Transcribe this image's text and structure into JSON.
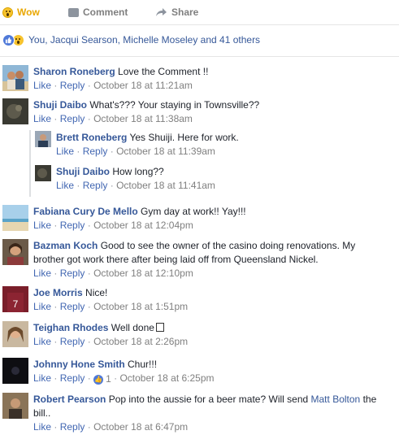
{
  "actions": {
    "wow_label": "Wow",
    "comment_label": "Comment",
    "share_label": "Share"
  },
  "reactions": {
    "summary": "You, Jacqui Searson, Michelle Moseley and 41 others"
  },
  "colors": {
    "link": "#365899",
    "meta": "#7f7f7f",
    "wow": "#e9a700"
  },
  "comments": [
    {
      "author": "Sharon Roneberg",
      "text": "Love the Comment !!",
      "like": "Like",
      "reply": "Reply",
      "time": "October 18 at 11:21am",
      "avatar": "beach-couple-avatar"
    },
    {
      "author": "Shuji Daibo",
      "text": "What's??? Your staying in Townsville??",
      "like": "Like",
      "reply": "Reply",
      "time": "October 18 at 11:38am",
      "avatar": "dark-photo-avatar"
    },
    {
      "author": "Brett Roneberg",
      "text": "Yes Shuiji. Here for work.",
      "like": "Like",
      "reply": "Reply",
      "time": "October 18 at 11:39am",
      "avatar": "man-avatar"
    },
    {
      "author": "Shuji Daibo",
      "text": "How long??",
      "like": "Like",
      "reply": "Reply",
      "time": "October 18 at 11:41am",
      "avatar": "dark-photo-avatar"
    },
    {
      "author": "Fabiana Cury De Mello",
      "text": "Gym day at work!! Yay!!!",
      "like": "Like",
      "reply": "Reply",
      "time": "October 18 at 12:04pm",
      "avatar": "beach-avatar"
    },
    {
      "author": "Bazman Koch",
      "text_line1": "Good to see the owner of the casino doing renovations. My",
      "text_line2": "brother got work there after being laid off from Queensland Nickel.",
      "like": "Like",
      "reply": "Reply",
      "time": "October 18 at 12:10pm",
      "avatar": "woman-avatar"
    },
    {
      "author": "Joe Morris",
      "text": "Nice!",
      "like": "Like",
      "reply": "Reply",
      "time": "October 18 at 1:51pm",
      "avatar": "jersey-avatar"
    },
    {
      "author": "Teighan Rhodes",
      "text": "Well done",
      "like": "Like",
      "reply": "Reply",
      "time": "October 18 at 2:26pm",
      "avatar": "woman-avatar"
    },
    {
      "author": "Johnny Hone Smith",
      "text": "Chur!!!",
      "like": "Like",
      "reply": "Reply",
      "like_count": "1",
      "time": "October 18 at 6:25pm",
      "avatar": "dark-avatar"
    },
    {
      "author": "Robert Pearson",
      "text_pre": "Pop into the aussie for a beer mate? Will send",
      "mention": "Matt Bolton",
      "text_post": "the",
      "text_line2": "bill..",
      "like": "Like",
      "reply": "Reply",
      "time": "October 18 at 6:47pm",
      "avatar": "man-avatar"
    }
  ]
}
